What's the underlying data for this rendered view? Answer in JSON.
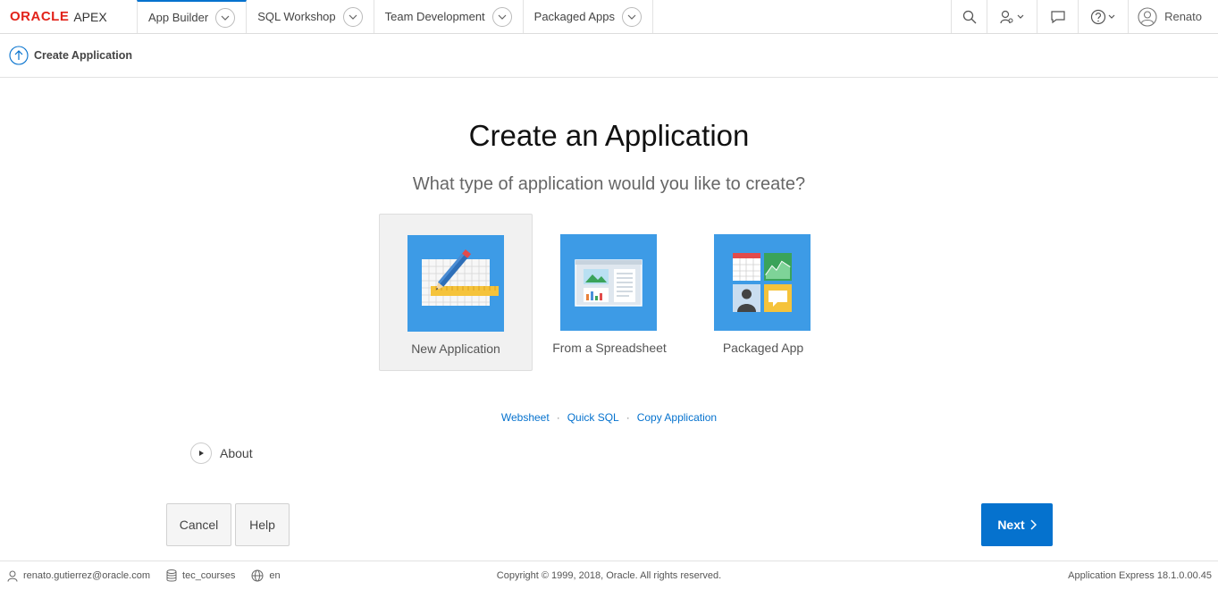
{
  "brand": {
    "oracle": "ORACLE",
    "apex": "APEX",
    "color": "#e2231a"
  },
  "nav": {
    "tabs": [
      {
        "label": "App Builder"
      },
      {
        "label": "SQL Workshop"
      },
      {
        "label": "Team Development"
      },
      {
        "label": "Packaged Apps"
      }
    ],
    "user": "Renato",
    "icons": [
      "search-icon",
      "admin-icon",
      "feedback-icon",
      "help-icon",
      "user-icon"
    ]
  },
  "breadcrumb": {
    "label": "Create Application",
    "icon": "up-arrow-icon"
  },
  "main": {
    "title": "Create an Application",
    "subtitle": "What type of application would you like to create?",
    "options": [
      {
        "label": "New Application",
        "selected": true,
        "icon": "new-application-icon"
      },
      {
        "label": "From a Spreadsheet",
        "selected": false,
        "icon": "spreadsheet-icon"
      },
      {
        "label": "Packaged App",
        "selected": false,
        "icon": "packaged-app-icon"
      }
    ],
    "links": [
      "Websheet",
      "Quick SQL",
      "Copy Application"
    ],
    "about": "About"
  },
  "buttons": {
    "cancel": "Cancel",
    "help": "Help",
    "next": "Next"
  },
  "footer": {
    "user": "renato.gutierrez@oracle.com",
    "workspace": "tec_courses",
    "language": "en",
    "copyright": "Copyright © 1999, 2018, Oracle. All rights reserved.",
    "version": "Application Express 18.1.0.00.45"
  },
  "colors": {
    "accent": "#0572ce",
    "tile": "#3d9be6"
  }
}
